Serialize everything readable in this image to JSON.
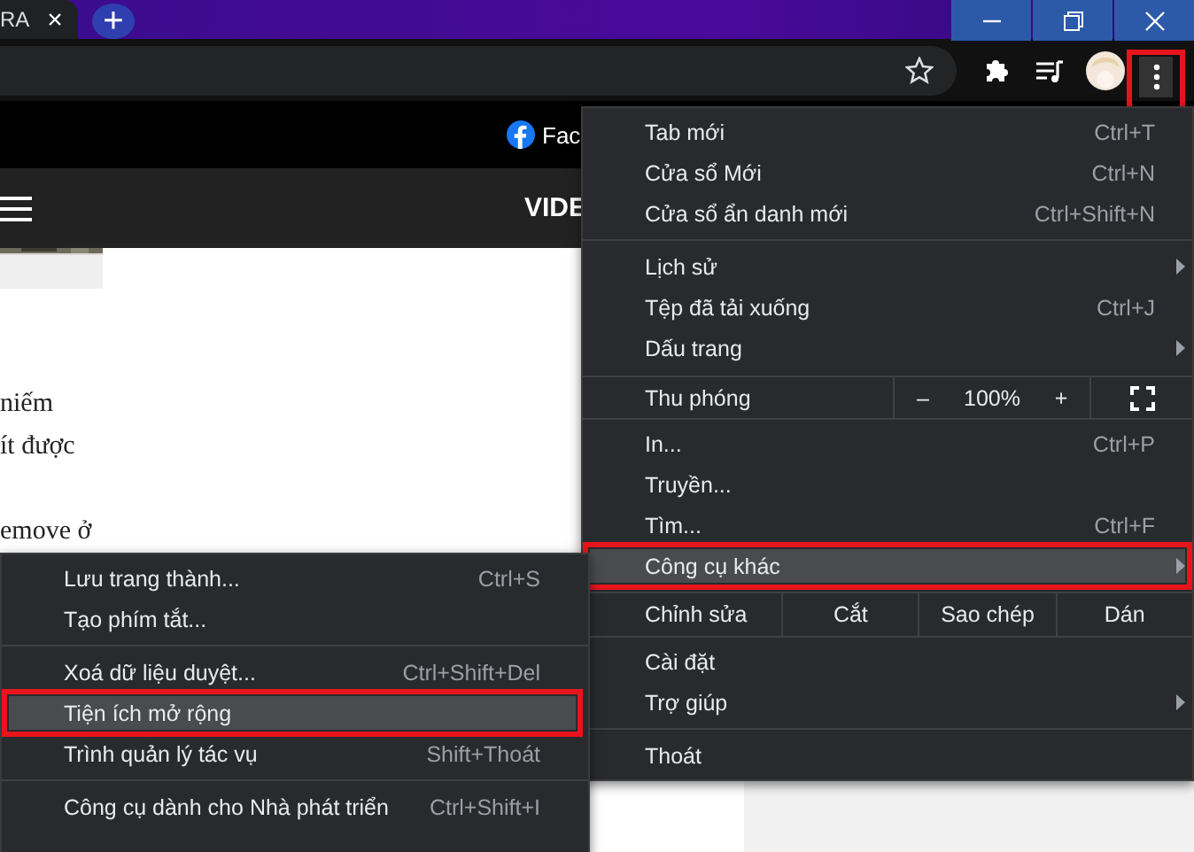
{
  "tab_strip": {
    "tab": {
      "title": "RA",
      "close": "×"
    },
    "new_tab": "+"
  },
  "toolbar": {
    "menu_button": {
      "annotated": true
    }
  },
  "page": {
    "banner": {
      "link": "Fac"
    },
    "nav": {
      "title": "VIDE"
    },
    "paragraph_lines": [
      "niếm",
      "ít được"
    ],
    "next_paragraph": "emove ở"
  },
  "menu": {
    "items": [
      {
        "kind": "item",
        "label": "Tab mới",
        "shortcut": "Ctrl+T",
        "submenu": false,
        "selected": false,
        "annotated": false
      },
      {
        "kind": "item",
        "label": "Cửa sổ Mới",
        "shortcut": "Ctrl+N",
        "submenu": false,
        "selected": false,
        "annotated": false
      },
      {
        "kind": "item",
        "label": "Cửa sổ ẩn danh mới",
        "shortcut": "Ctrl+Shift+N",
        "submenu": false,
        "selected": false,
        "annotated": false
      },
      {
        "kind": "separator"
      },
      {
        "kind": "item",
        "label": "Lịch sử",
        "submenu": true,
        "selected": false,
        "annotated": false
      },
      {
        "kind": "item",
        "label": "Tệp đã tải xuống",
        "shortcut": "Ctrl+J",
        "submenu": false,
        "selected": false,
        "annotated": false
      },
      {
        "kind": "item",
        "label": "Dấu trang",
        "submenu": true,
        "selected": false,
        "annotated": false
      },
      {
        "kind": "zoom",
        "label": "Thu phóng",
        "minus": "–",
        "value": "100%",
        "plus": "+"
      },
      {
        "kind": "item",
        "label": "In...",
        "shortcut": "Ctrl+P",
        "submenu": false,
        "selected": false,
        "annotated": false
      },
      {
        "kind": "item",
        "label": "Truyền...",
        "submenu": false,
        "selected": false,
        "annotated": false
      },
      {
        "kind": "item",
        "label": "Tìm...",
        "shortcut": "Ctrl+F",
        "submenu": false,
        "selected": false,
        "annotated": false
      },
      {
        "kind": "item",
        "label": "Công cụ khác",
        "submenu": true,
        "selected": true,
        "annotated": true
      },
      {
        "kind": "edit",
        "label": "Chỉnh sửa",
        "actions": [
          "Cắt",
          "Sao chép",
          "Dán"
        ]
      },
      {
        "kind": "item",
        "label": "Cài đặt",
        "submenu": false,
        "selected": false,
        "annotated": false
      },
      {
        "kind": "item",
        "label": "Trợ giúp",
        "submenu": true,
        "selected": false,
        "annotated": false
      },
      {
        "kind": "separator"
      },
      {
        "kind": "item",
        "label": "Thoát",
        "submenu": false,
        "selected": false,
        "annotated": false
      }
    ]
  },
  "submenu": {
    "items": [
      {
        "kind": "item",
        "label": "Lưu trang thành...",
        "shortcut": "Ctrl+S",
        "selected": false,
        "annotated": false
      },
      {
        "kind": "item",
        "label": "Tạo phím tắt...",
        "selected": false,
        "annotated": false
      },
      {
        "kind": "separator"
      },
      {
        "kind": "item",
        "label": "Xoá dữ liệu duyệt...",
        "shortcut": "Ctrl+Shift+Del",
        "selected": false,
        "annotated": false
      },
      {
        "kind": "item",
        "label": "Tiện ích mở rộng",
        "selected": true,
        "annotated": true
      },
      {
        "kind": "item",
        "label": "Trình quản lý tác vụ",
        "shortcut": "Shift+Thoát",
        "selected": false,
        "annotated": false
      },
      {
        "kind": "separator"
      },
      {
        "kind": "item",
        "label": "Công cụ dành cho Nhà phát triển",
        "shortcut": "Ctrl+Shift+I",
        "selected": false,
        "annotated": false
      }
    ]
  }
}
